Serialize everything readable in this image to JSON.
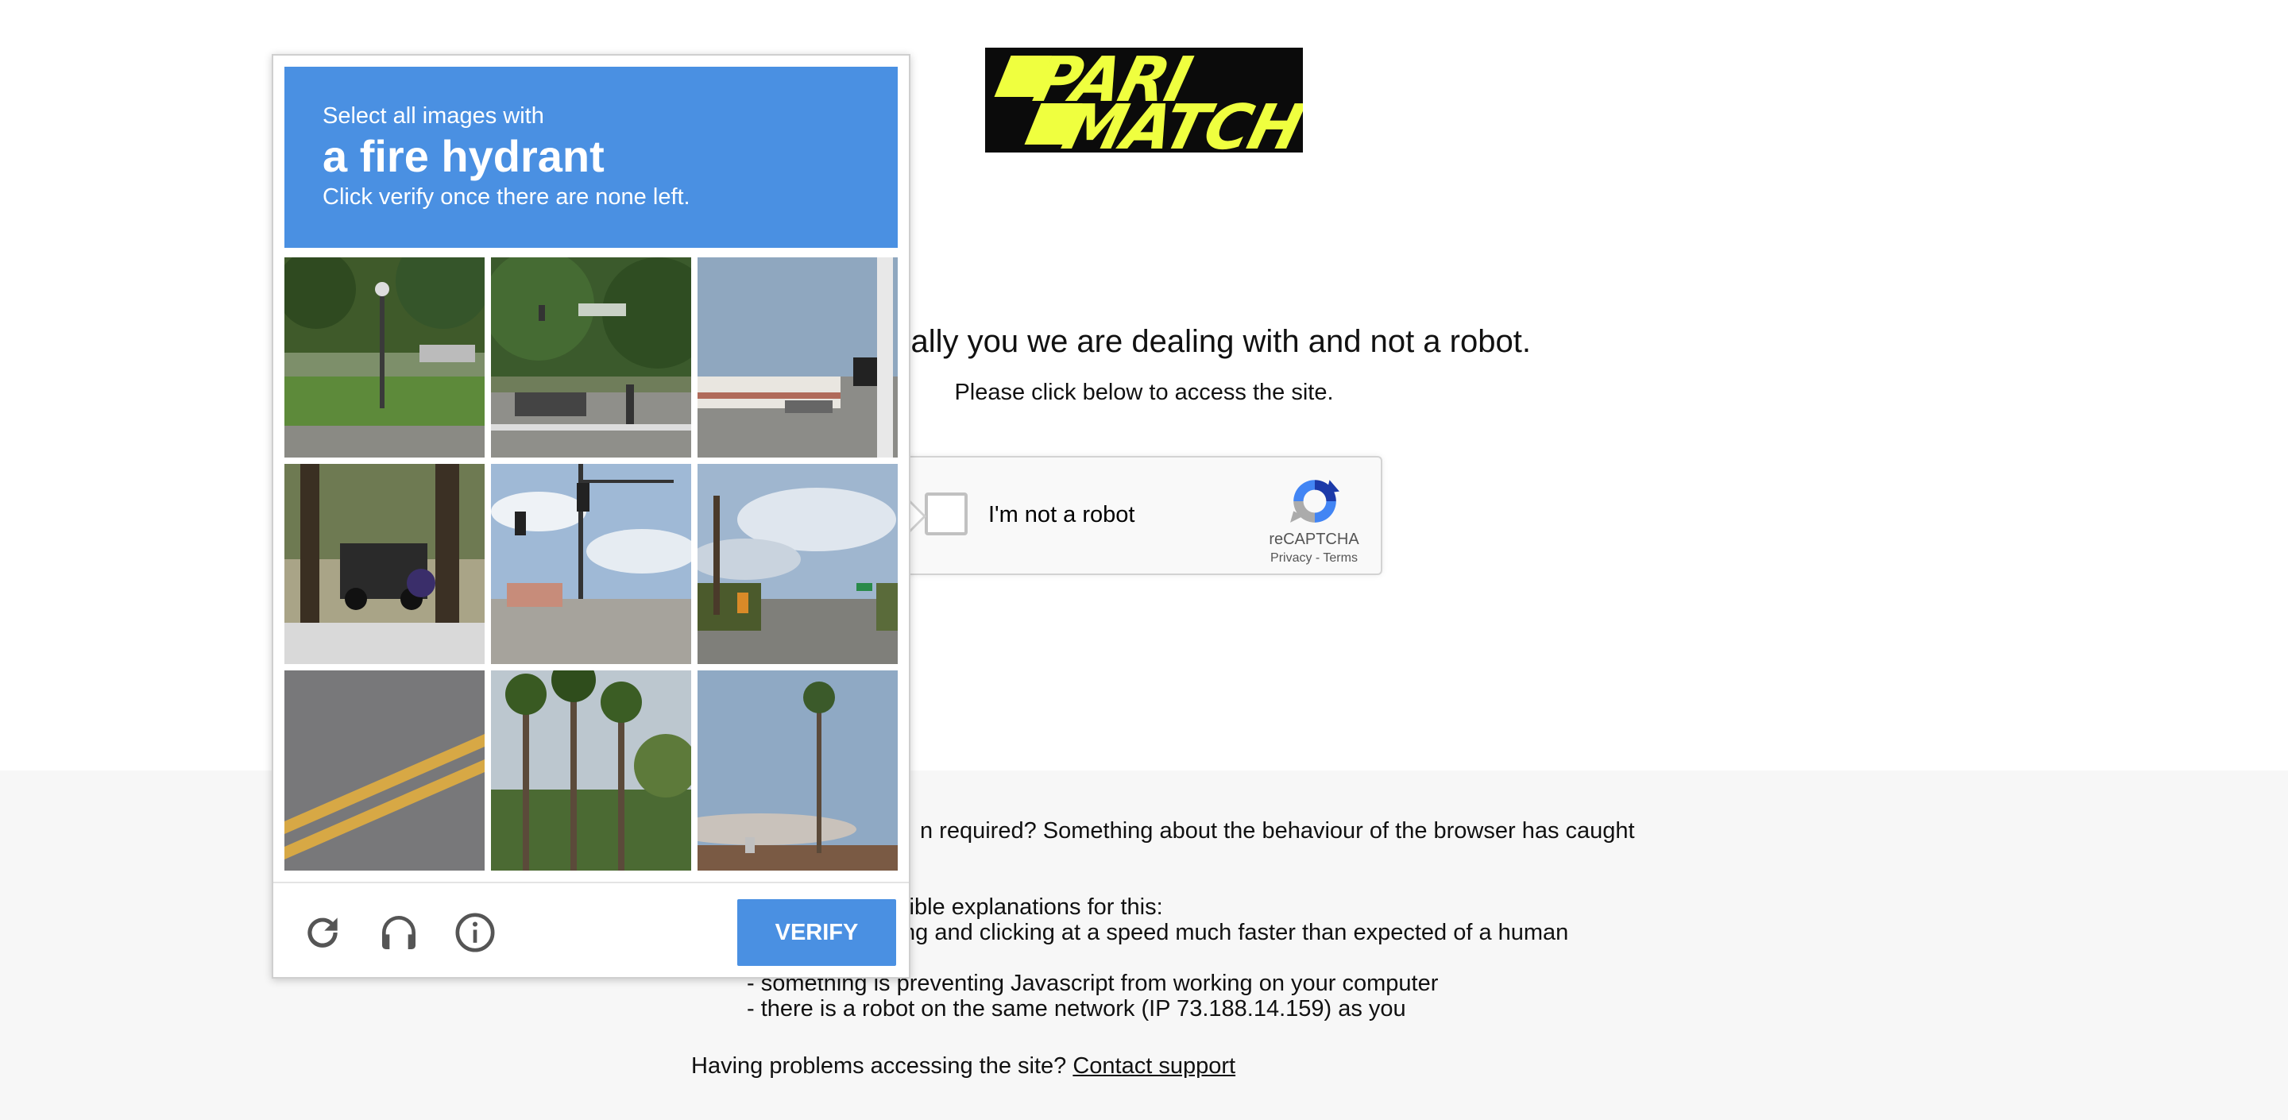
{
  "logo": {
    "line1": "PARI",
    "line2": "MATCH"
  },
  "main": {
    "headline": "re it is actually you we are dealing with and not a robot.",
    "subline": "Please click below to access the site."
  },
  "recaptcha": {
    "checkbox_label": "I'm not a robot",
    "brand": "reCAPTCHA",
    "privacy": "Privacy",
    "terms_sep": " - ",
    "terms": "Terms"
  },
  "info": {
    "line1": "n required? Something about the behaviour of the browser has caught",
    "line2": "sible explanations for this:",
    "line3": "ng and clicking at a speed much faster than expected of a human",
    "line4": "- something is preventing Javascript from working on your computer",
    "line5": "- there is a robot on the same network (IP 73.188.14.159) as you",
    "problems_text": "Having problems accessing the site? ",
    "contact_link": "Contact support"
  },
  "challenge": {
    "instruction_small": "Select all images with",
    "instruction_target": "a fire hydrant",
    "instruction_note": "Click verify once there are none left.",
    "verify_label": "VERIFY",
    "icons": [
      "reload-icon",
      "audio-headphones-icon",
      "info-icon"
    ],
    "tiles": [
      "park with street lamp",
      "intersection with traffic lights",
      "street corner with signal pole",
      "parked car and motorcyclist",
      "intersection with traffic lights",
      "road with utility pole",
      "road with yellow lines",
      "tall palm trees",
      "palm tree and building"
    ]
  },
  "colors": {
    "accent": "#4a90e2",
    "logo_bg": "#0b0b0b",
    "logo_fg": "#efff3f",
    "panel_bg": "#f7f7f7"
  }
}
